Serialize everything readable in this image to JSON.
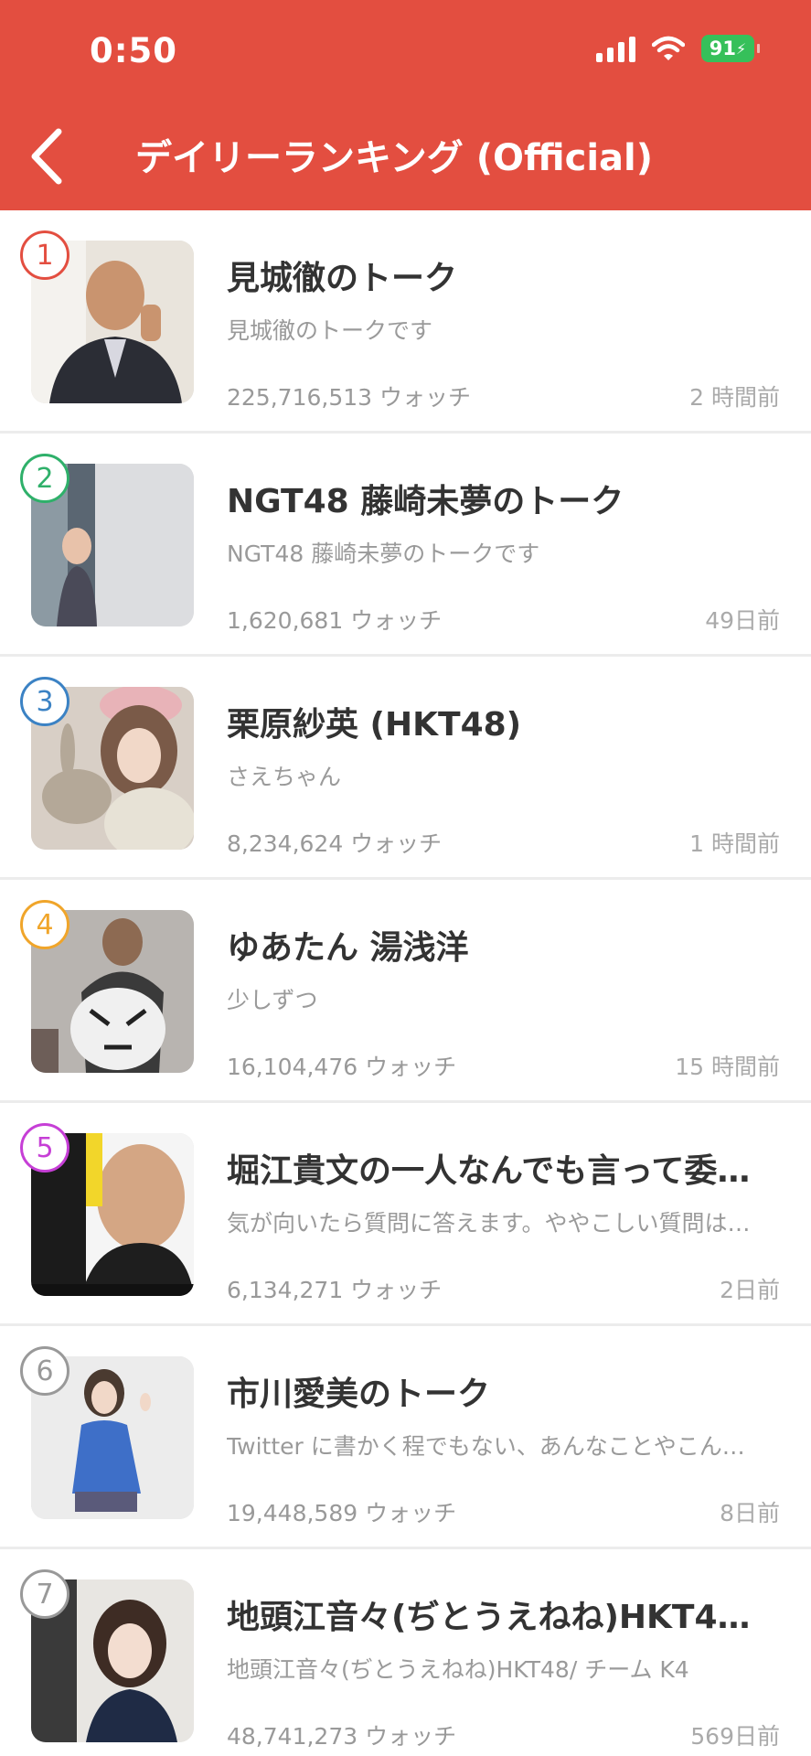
{
  "status_bar": {
    "time": "0:50",
    "battery": "91"
  },
  "nav": {
    "title": "デイリーランキング (Official)"
  },
  "colors": {
    "header_bg": "#e34e40",
    "rank1": "#e34e40",
    "rank2": "#2fb06a",
    "rank3": "#3b82c4",
    "rank4": "#f0a52a",
    "rank5": "#c63fd6",
    "rank_other": "#999999"
  },
  "items": [
    {
      "rank": "1",
      "title": "見城徹のトーク",
      "desc": "見城徹のトークです",
      "watch": "225,716,513 ウォッチ",
      "time": "2 時間前"
    },
    {
      "rank": "2",
      "title": "NGT48 藤崎未夢のトーク",
      "desc": "NGT48 藤崎未夢のトークです",
      "watch": "1,620,681 ウォッチ",
      "time": "49日前"
    },
    {
      "rank": "3",
      "title": "栗原紗英 (HKT48)",
      "desc": "さえちゃん",
      "watch": "8,234,624 ウォッチ",
      "time": "1 時間前"
    },
    {
      "rank": "4",
      "title": "ゆあたん 湯浅洋",
      "desc": "少しずつ",
      "watch": "16,104,476 ウォッチ",
      "time": "15 時間前"
    },
    {
      "rank": "5",
      "title": "堀江貴文の一人なんでも言って委…",
      "desc": "気が向いたら質問に答えます。ややこしい質問は…",
      "watch": "6,134,271 ウォッチ",
      "time": "2日前"
    },
    {
      "rank": "6",
      "title": "市川愛美のトーク",
      "desc": "Twitter に書かく程でもない、あんなことやこん…",
      "watch": "19,448,589 ウォッチ",
      "time": "8日前"
    },
    {
      "rank": "7",
      "title": "地頭江音々(ぢとうえねね)HKT4…",
      "desc": "地頭江音々(ぢとうえねね)HKT48/ チーム K4",
      "watch": "48,741,273 ウォッチ",
      "time": "569日前"
    }
  ]
}
